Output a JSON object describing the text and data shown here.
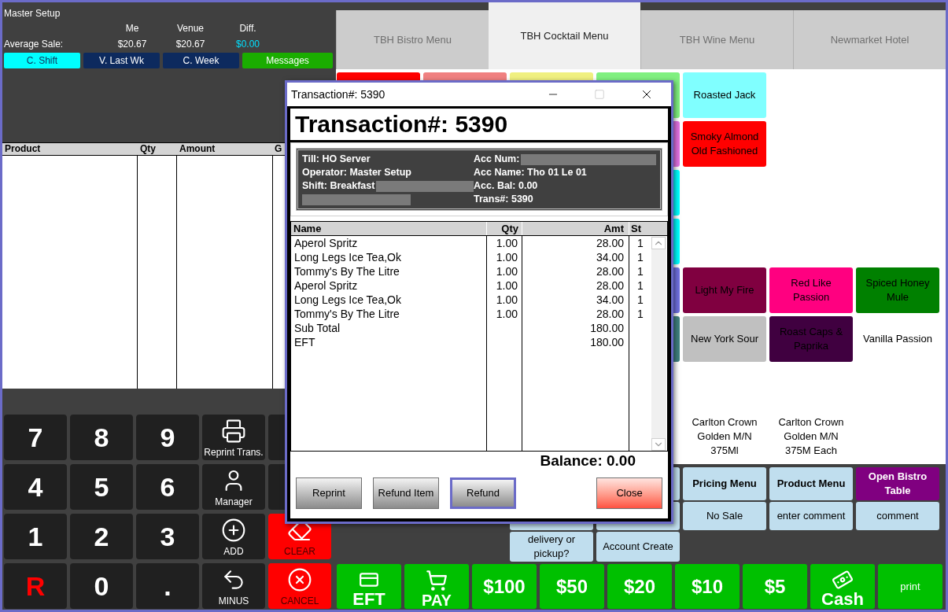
{
  "header": {
    "operator": "Master Setup",
    "columns": [
      "Me",
      "Venue",
      "Diff."
    ],
    "row_label": "Average Sale:",
    "values": [
      "$20.67",
      "$20.67",
      "$0.00"
    ]
  },
  "period_buttons": [
    {
      "label": "C. Shift",
      "selected": true
    },
    {
      "label": "V. Last Wk",
      "selected": false
    },
    {
      "label": "C. Week",
      "selected": false
    }
  ],
  "messages_button": {
    "label": "Messages"
  },
  "order_table": {
    "columns": [
      "Product",
      "Qty",
      "Amount",
      "G"
    ]
  },
  "keypad": [
    [
      {
        "kind": "digit",
        "label": "7"
      },
      {
        "kind": "digit",
        "label": "8"
      },
      {
        "kind": "digit",
        "label": "9"
      },
      {
        "kind": "printer",
        "label": "Reprint Trans."
      },
      {
        "kind": "blank"
      }
    ],
    [
      {
        "kind": "digit",
        "label": "4"
      },
      {
        "kind": "digit",
        "label": "5"
      },
      {
        "kind": "digit",
        "label": "6"
      },
      {
        "kind": "manager",
        "label": "Manager"
      },
      {
        "kind": "blank"
      }
    ],
    [
      {
        "kind": "digit",
        "label": "1"
      },
      {
        "kind": "digit",
        "label": "2"
      },
      {
        "kind": "digit",
        "label": "3"
      },
      {
        "kind": "add",
        "label": "ADD"
      },
      {
        "kind": "clear",
        "label": "CLEAR"
      }
    ],
    [
      {
        "kind": "reset",
        "label": "R"
      },
      {
        "kind": "digit",
        "label": "0"
      },
      {
        "kind": "digit",
        "label": "."
      },
      {
        "kind": "minus",
        "label": "MINUS"
      },
      {
        "kind": "cancel",
        "label": "CANCEL"
      }
    ]
  ],
  "menu_tabs": [
    {
      "label": "TBH Bistro Menu",
      "selected": false
    },
    {
      "label": "TBH Cocktail Menu",
      "selected": true
    },
    {
      "label": "TBH Wine Menu",
      "selected": false
    },
    {
      "label": "Newmarket Hotel",
      "selected": false
    }
  ],
  "product_rows": [
    [
      {
        "kind": "tile",
        "color": "#ff0000"
      },
      {
        "kind": "tile",
        "color": "#f08080"
      },
      {
        "kind": "tile",
        "color": "#f0f080"
      },
      {
        "kind": "tile",
        "color": "#80f080"
      },
      {
        "kind": "tile",
        "color": "#80ffff",
        "label": "Roasted Jack"
      },
      {
        "kind": "empty"
      },
      {
        "kind": "empty"
      }
    ],
    [
      {
        "kind": "empty"
      },
      {
        "kind": "empty"
      },
      {
        "kind": "empty"
      },
      {
        "kind": "tile",
        "color": "#e070e0"
      },
      {
        "kind": "tile",
        "color": "#ff0000",
        "label": "Smoky Almond Old Fashioned"
      },
      {
        "kind": "empty"
      },
      {
        "kind": "empty"
      }
    ],
    [
      {
        "kind": "empty"
      },
      {
        "kind": "empty"
      },
      {
        "kind": "empty"
      },
      {
        "kind": "tile",
        "color": "#00ffff"
      },
      {
        "kind": "empty"
      },
      {
        "kind": "empty"
      },
      {
        "kind": "empty"
      }
    ],
    [
      {
        "kind": "empty"
      },
      {
        "kind": "empty"
      },
      {
        "kind": "empty"
      },
      {
        "kind": "tile",
        "color": "#00ffff"
      },
      {
        "kind": "empty"
      },
      {
        "kind": "empty"
      },
      {
        "kind": "empty"
      }
    ],
    [
      {
        "kind": "empty"
      },
      {
        "kind": "empty"
      },
      {
        "kind": "empty"
      },
      {
        "kind": "tile",
        "color": "#7070e0"
      },
      {
        "kind": "tile",
        "color": "#800040",
        "label": "Light My Fire"
      },
      {
        "kind": "tile",
        "color": "#ff0080",
        "label": "Red Like Passion"
      },
      {
        "kind": "tile",
        "color": "#008000",
        "label": "Spiced Honey Mule"
      }
    ],
    [
      {
        "kind": "empty"
      },
      {
        "kind": "empty"
      },
      {
        "kind": "empty"
      },
      {
        "kind": "tile",
        "color": "#408080"
      },
      {
        "kind": "tile",
        "color": "#c0c0c0",
        "label": "New York Sour"
      },
      {
        "kind": "tile",
        "color": "#400040",
        "label": "Roast Caps & Paprika"
      },
      {
        "kind": "tile",
        "color": "#ffffff",
        "label": "Vanilla Passion"
      }
    ],
    [
      {
        "kind": "empty"
      },
      {
        "kind": "empty"
      },
      {
        "kind": "empty"
      },
      {
        "kind": "empty"
      },
      {
        "kind": "empty"
      },
      {
        "kind": "empty"
      },
      {
        "kind": "empty"
      }
    ],
    [
      {
        "kind": "empty"
      },
      {
        "kind": "empty"
      },
      {
        "kind": "empty"
      },
      {
        "kind": "empty"
      },
      {
        "kind": "tile",
        "color": "#ffffff",
        "label": "Carlton Crown Golden M/N 375Ml"
      },
      {
        "kind": "tile",
        "color": "#ffffff",
        "label": "Carlton Crown Golden M/N 375M Each"
      },
      {
        "kind": "empty"
      }
    ]
  ],
  "function_rows": [
    [
      {
        "kind": "empty"
      },
      {
        "kind": "empty"
      },
      {
        "kind": "empty"
      },
      {
        "kind": "tile",
        "color": "#c0deee"
      },
      {
        "kind": "tile",
        "color": "#c0deee",
        "label": "Pricing Menu",
        "bold": true
      },
      {
        "kind": "tile",
        "color": "#c0deee",
        "label": "Product Menu",
        "bold": true
      },
      {
        "kind": "tile",
        "color": "#800080",
        "label": "Open Bistro Table",
        "bold": true
      }
    ],
    [
      {
        "kind": "empty"
      },
      {
        "kind": "empty"
      },
      {
        "kind": "tile",
        "color": "#c0deee"
      },
      {
        "kind": "tile",
        "color": "#c0deee"
      },
      {
        "kind": "tile",
        "color": "#c0deee",
        "label": "No Sale",
        "bold": false
      },
      {
        "kind": "tile",
        "color": "#c0deee",
        "label": "enter comment",
        "bold": false
      },
      {
        "kind": "tile",
        "color": "#c0deee",
        "label": "comment",
        "bold": false
      }
    ],
    [
      {
        "kind": "empty"
      },
      {
        "kind": "empty"
      },
      {
        "kind": "tile",
        "color": "#c0deee",
        "label": "delivery or pickup?",
        "bold": false
      },
      {
        "kind": "tile",
        "color": "#c0deee",
        "label": "Account Create",
        "bold": false
      },
      {
        "kind": "empty"
      },
      {
        "kind": "empty"
      },
      {
        "kind": "empty"
      }
    ]
  ],
  "pay_buttons": [
    {
      "kind": "card",
      "label": "EFT"
    },
    {
      "kind": "cart",
      "label": "PAY"
    },
    {
      "kind": "amount",
      "label": "$100"
    },
    {
      "kind": "amount",
      "label": "$50"
    },
    {
      "kind": "amount",
      "label": "$20"
    },
    {
      "kind": "amount",
      "label": "$10"
    },
    {
      "kind": "amount",
      "label": "$5"
    },
    {
      "kind": "cash",
      "label": "Cash"
    },
    {
      "kind": "text",
      "label": "print"
    }
  ],
  "dialog": {
    "title": "Transaction#: 5390",
    "heading": "Transaction#: 5390",
    "info_left": [
      {
        "text": "Till: HO Server",
        "redacted": false
      },
      {
        "text": "Operator: Master Setup",
        "redacted": false
      },
      {
        "text": "Shift: Breakfast",
        "redacted": true
      },
      {
        "redacted": true
      }
    ],
    "info_right": [
      {
        "text": "Acc Num:",
        "redacted": true
      },
      {
        "text": "Acc Name: Tho 01 Le 01",
        "redacted": false
      },
      {
        "text": "Acc. Bal: 0.00",
        "redacted": false
      },
      {
        "text": "Trans#: 5390",
        "redacted": false
      }
    ],
    "columns": [
      "Name",
      "Qty",
      "Amt",
      "St"
    ],
    "rows": [
      {
        "name": "Aperol Spritz",
        "qty": "1.00",
        "amt": "28.00",
        "st": "1"
      },
      {
        "name": "Long Legs Ice Tea,Ok",
        "qty": "1.00",
        "amt": "34.00",
        "st": "1"
      },
      {
        "name": "Tommy's By The Litre",
        "qty": "1.00",
        "amt": "28.00",
        "st": "1"
      },
      {
        "name": "Aperol Spritz",
        "qty": "1.00",
        "amt": "28.00",
        "st": "1"
      },
      {
        "name": "Long Legs Ice Tea,Ok",
        "qty": "1.00",
        "amt": "34.00",
        "st": "1"
      },
      {
        "name": "Tommy's By The Litre",
        "qty": "1.00",
        "amt": "28.00",
        "st": "1"
      },
      {
        "name": "Sub Total",
        "amt": "180.00"
      },
      {
        "name": "EFT",
        "amt": "180.00"
      }
    ],
    "balance": "Balance: 0.00",
    "buttons": [
      {
        "kind": "action",
        "label": "Reprint",
        "focused": false
      },
      {
        "kind": "action",
        "label": "Refund Item",
        "focused": false
      },
      {
        "kind": "action",
        "label": "Refund",
        "focused": true
      },
      {
        "kind": "close",
        "label": "Close",
        "focused": false
      }
    ]
  }
}
